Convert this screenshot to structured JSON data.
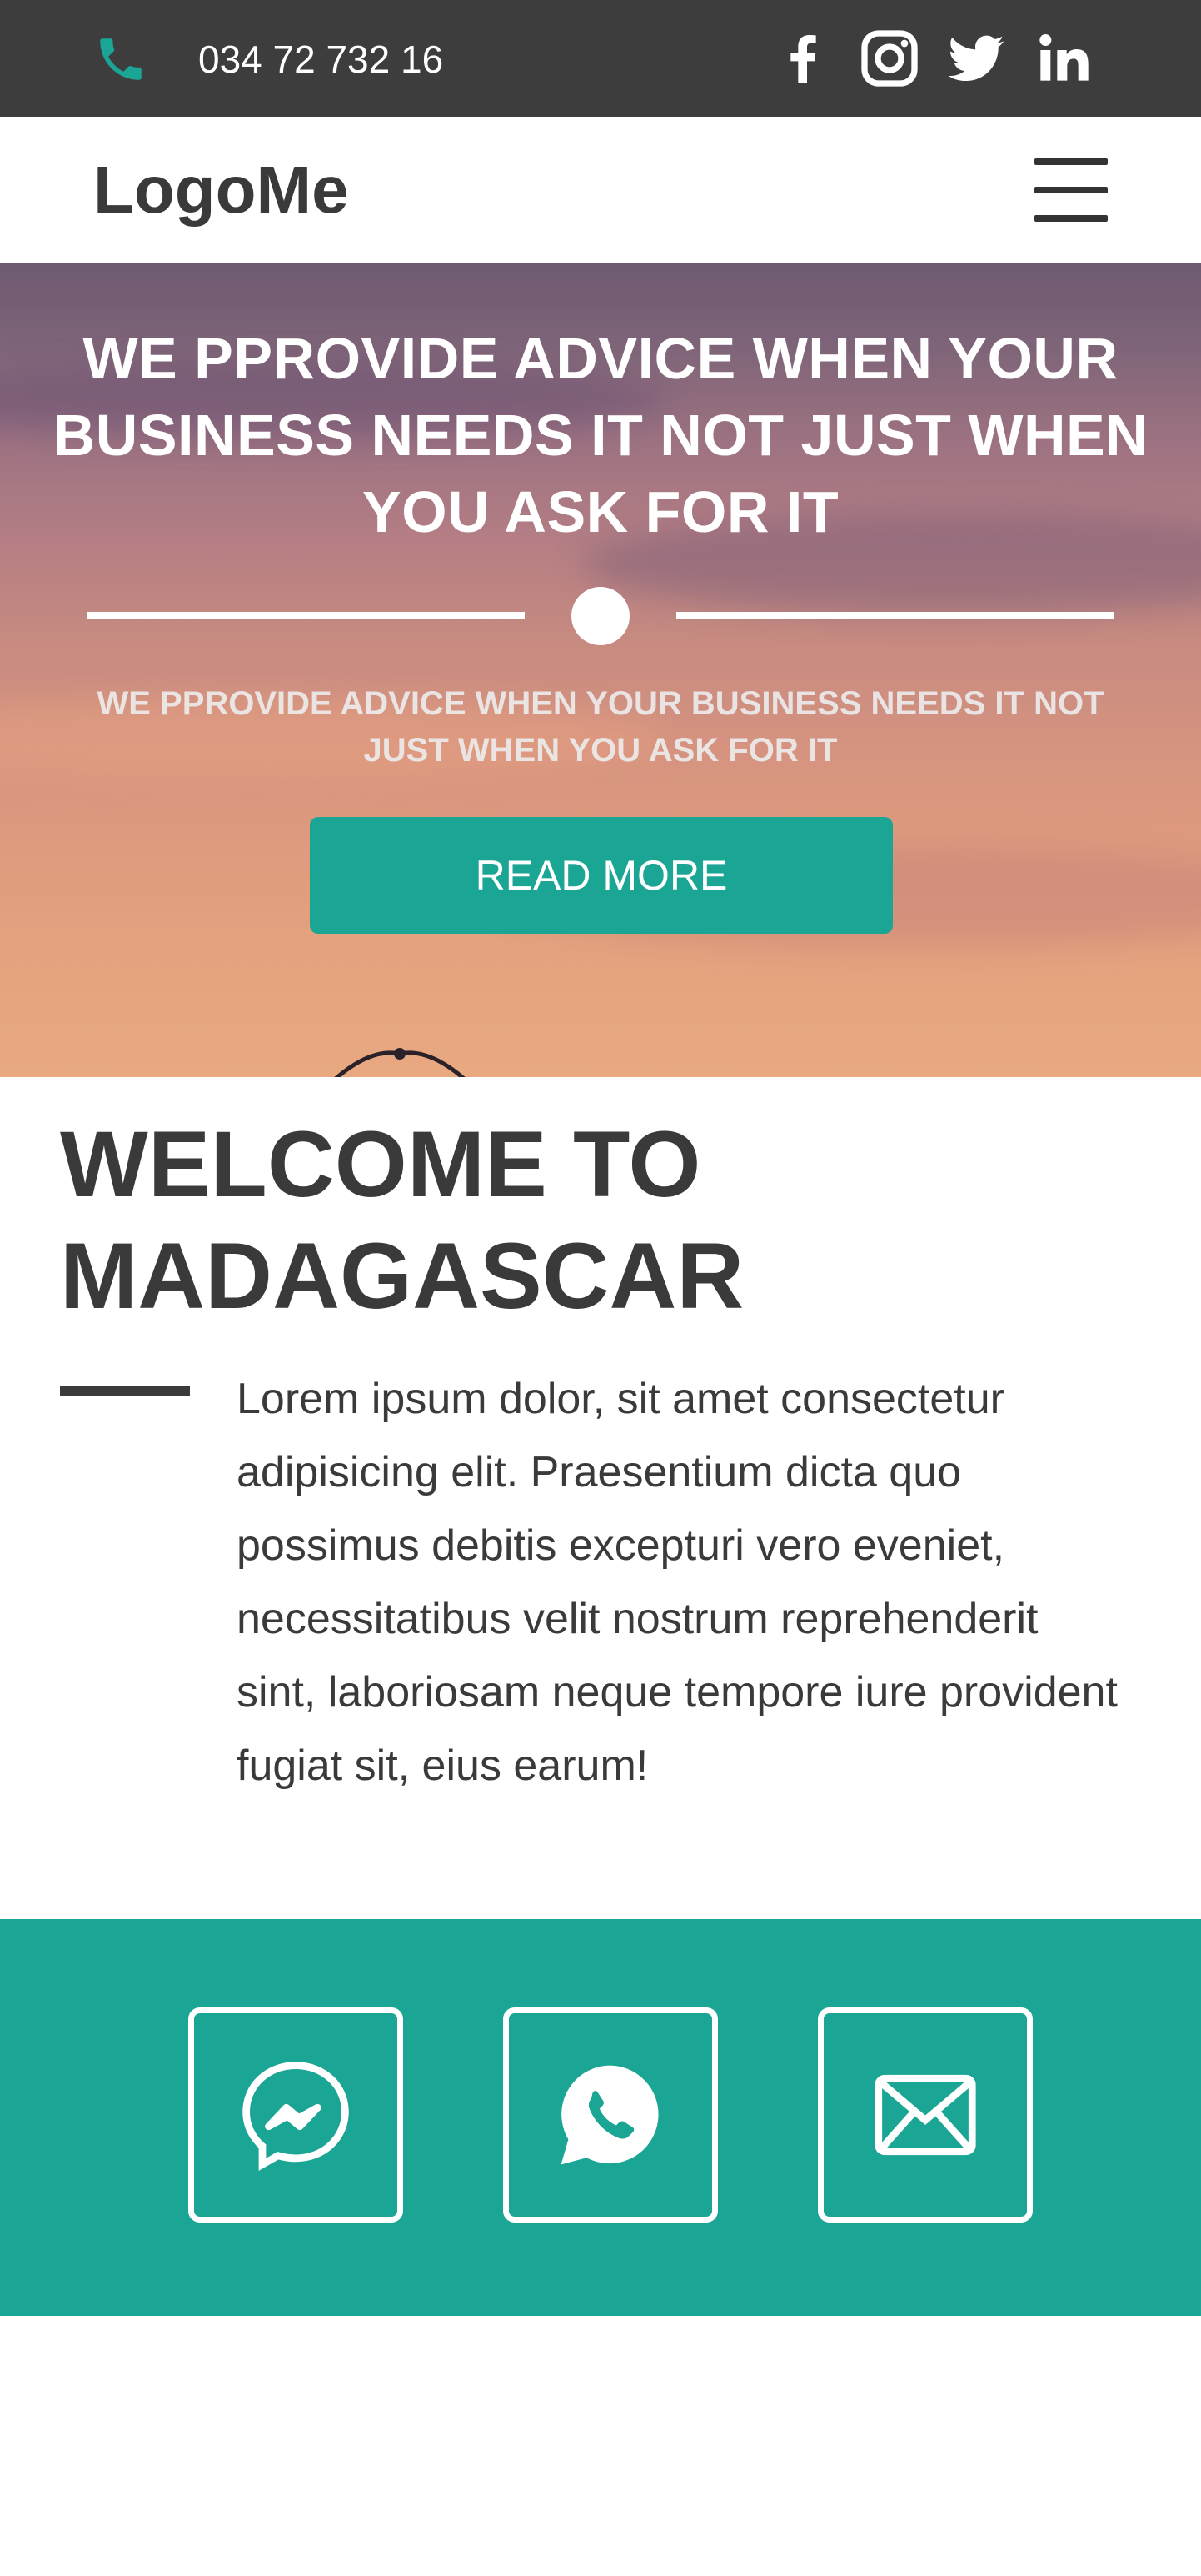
{
  "topbar": {
    "phone": "034 72 732 16",
    "phone_icon": "phone-icon",
    "social": [
      "facebook-icon",
      "instagram-icon",
      "twitter-icon",
      "linkedin-icon"
    ]
  },
  "header": {
    "logo": "LogoMe",
    "menu_icon": "hamburger-menu-icon"
  },
  "hero": {
    "title": "WE PPROVIDE ADVICE WHEN YOUR BUSINESS NEEDS IT NOT JUST WHEN YOU ASK FOR IT",
    "subtitle": "WE PPROVIDE ADVICE WHEN YOUR BUSINESS NEEDS IT NOT JUST WHEN YOU ASK FOR IT",
    "button_label": "READ MORE"
  },
  "welcome": {
    "title": "WELCOME TO MADAGASCAR",
    "text": "Lorem ipsum dolor, sit amet consectetur adipisicing elit. Praesentium dicta quo possimus debitis excepturi vero eveniet, necessitatibus velit nostrum reprehenderit sint, laboriosam neque tempore iure provident fugiat sit, eius earum!"
  },
  "contact": {
    "items": [
      "messenger-icon",
      "whatsapp-icon",
      "mail-icon"
    ]
  },
  "colors": {
    "topbar": "#3d3d3d",
    "accent": "#1aa595",
    "text": "#3a3a3a"
  }
}
